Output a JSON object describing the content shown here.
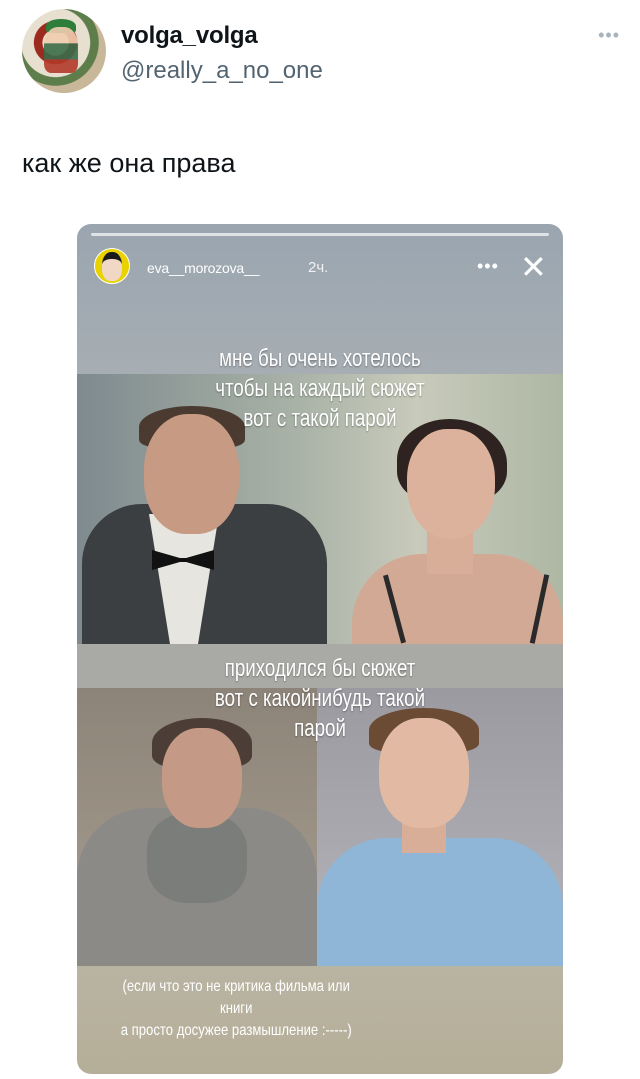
{
  "post": {
    "display_name": "volga_volga",
    "handle": "@really_a_no_one",
    "more_icon": "more-horizontal-icon",
    "text": "как же она права"
  },
  "story": {
    "username": "eva__morozova__",
    "time": "2ч.",
    "more_icon": "more-icon",
    "close_icon": "close-icon",
    "caption_top": [
      "мне бы очень хотелось",
      "чтобы на каждый сюжет",
      "вот с такой парой"
    ],
    "caption_middle": [
      "приходился бы сюжет",
      "вот с какойнибудь такой",
      "парой"
    ],
    "footnote": [
      "(если что это не критика фильма или книги",
      "а просто досужее размышление :-----)"
    ]
  }
}
